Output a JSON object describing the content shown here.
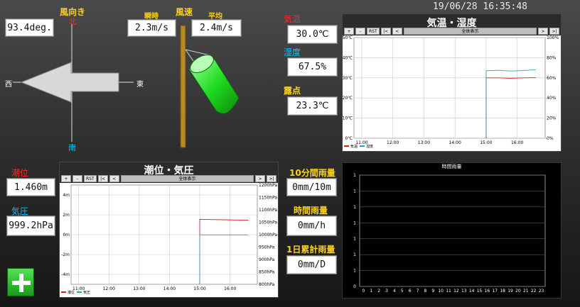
{
  "datetime": "19/06/28 16:35:48",
  "wind": {
    "direction_label": "風向き",
    "direction_value": "93.4deg.",
    "north": "北",
    "south": "南",
    "east": "東",
    "west": "西",
    "speed_label": "風速",
    "instant_label": "瞬時",
    "instant_value": "2.3m/s",
    "average_label": "平均",
    "average_value": "2.4m/s"
  },
  "weather": {
    "temp_label": "気温",
    "temp_value": "30.0℃",
    "humidity_label": "湿度",
    "humidity_value": "67.5%",
    "dew_label": "露点",
    "dew_value": "23.3℃"
  },
  "tide": {
    "tide_label": "潮位",
    "tide_value": "1.460m",
    "pressure_label": "気圧",
    "pressure_value": "999.2hPa"
  },
  "rain": {
    "ten_min_label": "10分間雨量",
    "ten_min_value": "0mm/10m",
    "hour_label": "時間雨量",
    "hour_value": "0mm/h",
    "day_label": "1日累計雨量",
    "day_value": "0mm/D"
  },
  "toolbar": {
    "plus": "+",
    "minus": "-",
    "rst": "RST",
    "first": "|<",
    "prev": "<",
    "all": "全体表示",
    "next": ">",
    "last": ">|"
  },
  "add_button_icon": "plus-icon",
  "colors": {
    "temp": "#d22020",
    "humidity": "#20a8b8",
    "tide": "#d22020",
    "pressure": "#20a8b8",
    "label_yellow": "#ffd21a",
    "label_red": "#ff2a2a",
    "label_cyan": "#00c8ff"
  },
  "chart_data": [
    {
      "type": "line",
      "title": "気温・湿度",
      "x": [
        "11:00",
        "12:00",
        "13:00",
        "14:00",
        "15:00",
        "16:00"
      ],
      "ylim_left": [
        0,
        50
      ],
      "yticks_left": [
        "50℃",
        "40℃",
        "30℃",
        "20℃",
        "10℃",
        "0℃"
      ],
      "ylim_right": [
        0,
        100
      ],
      "yticks_right": [
        "100%",
        "80%",
        "60%",
        "40%",
        "20%",
        "0%"
      ],
      "series": [
        {
          "name": "気温",
          "axis": "left",
          "color": "#d22020",
          "x_start": 15.0,
          "x_end": 16.6,
          "values": [
            30.0,
            30.0,
            29.8,
            30.0,
            30.1
          ]
        },
        {
          "name": "湿度",
          "axis": "right",
          "color": "#20a8b8",
          "x_start": 15.0,
          "x_end": 16.6,
          "values": [
            67.0,
            67.5,
            66.8,
            67.3,
            68.0
          ]
        }
      ],
      "grid": true,
      "legend": "bottom-left"
    },
    {
      "type": "line",
      "title": "潮位・気圧",
      "x": [
        "11:00",
        "12:00",
        "13:00",
        "14:00",
        "15:00",
        "16:00"
      ],
      "ylim_left": [
        -5,
        5
      ],
      "yticks_left": [
        "4m",
        "2m",
        "0m",
        "-2m",
        "-4m"
      ],
      "ylim_right": [
        800,
        1200
      ],
      "yticks_right": [
        "1200hPa",
        "1150hPa",
        "1100hPa",
        "1050hPa",
        "1000hPa",
        "950hPa",
        "900hPa",
        "850hPa",
        "800hPa"
      ],
      "series": [
        {
          "name": "潮位",
          "axis": "left",
          "color": "#d22020",
          "x_start": 15.0,
          "x_end": 16.6,
          "values": [
            1.55,
            1.52,
            1.5,
            1.48,
            1.46
          ]
        },
        {
          "name": "気圧",
          "axis": "right",
          "color": "#20a8b8",
          "x_start": 15.0,
          "x_end": 16.6,
          "values": [
            999.2,
            999.2,
            999.2,
            999.2,
            999.2
          ]
        }
      ],
      "grid": true,
      "legend": "bottom-left"
    },
    {
      "type": "bar",
      "title": "時間雨量",
      "categories": [
        "0",
        "1",
        "2",
        "3",
        "4",
        "5",
        "6",
        "7",
        "8",
        "9",
        "10",
        "11",
        "12",
        "13",
        "14",
        "15",
        "16",
        "17",
        "18",
        "19",
        "20",
        "21",
        "22",
        "23"
      ],
      "values": [
        0,
        0,
        0,
        0,
        0,
        0,
        0,
        0,
        0,
        0,
        0,
        0,
        0,
        0,
        0,
        0,
        0,
        0,
        0,
        0,
        0,
        0,
        0,
        0
      ],
      "ylim": [
        0,
        1
      ],
      "yticks": [
        "1",
        "1",
        "1",
        "1",
        "1",
        "1",
        "1",
        "0"
      ],
      "grid": true
    }
  ]
}
